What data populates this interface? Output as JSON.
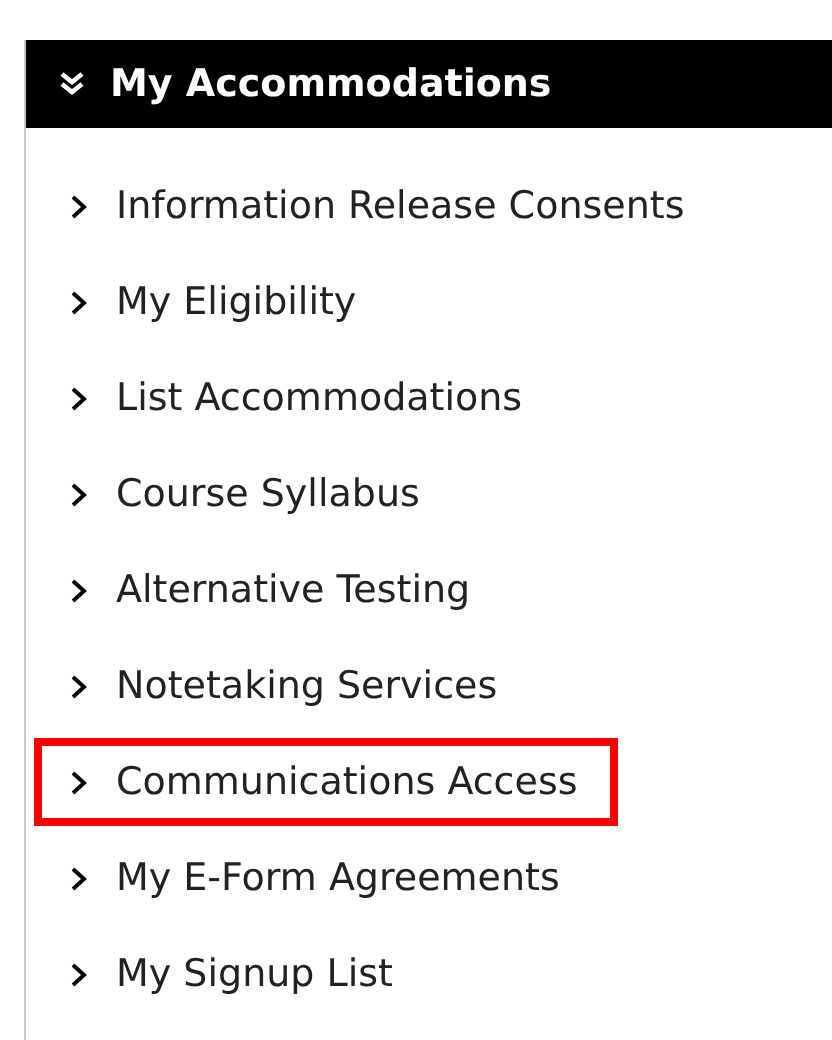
{
  "header": {
    "title": "My Accommodations",
    "expanded": true
  },
  "items": [
    {
      "label": "Information Release Consents",
      "highlighted": false
    },
    {
      "label": "My Eligibility",
      "highlighted": false
    },
    {
      "label": "List Accommodations",
      "highlighted": false
    },
    {
      "label": "Course Syllabus",
      "highlighted": false
    },
    {
      "label": "Alternative Testing",
      "highlighted": false
    },
    {
      "label": "Notetaking Services",
      "highlighted": false
    },
    {
      "label": "Communications Access",
      "highlighted": true
    },
    {
      "label": "My E-Form Agreements",
      "highlighted": false
    },
    {
      "label": "My Signup List",
      "highlighted": false
    }
  ]
}
